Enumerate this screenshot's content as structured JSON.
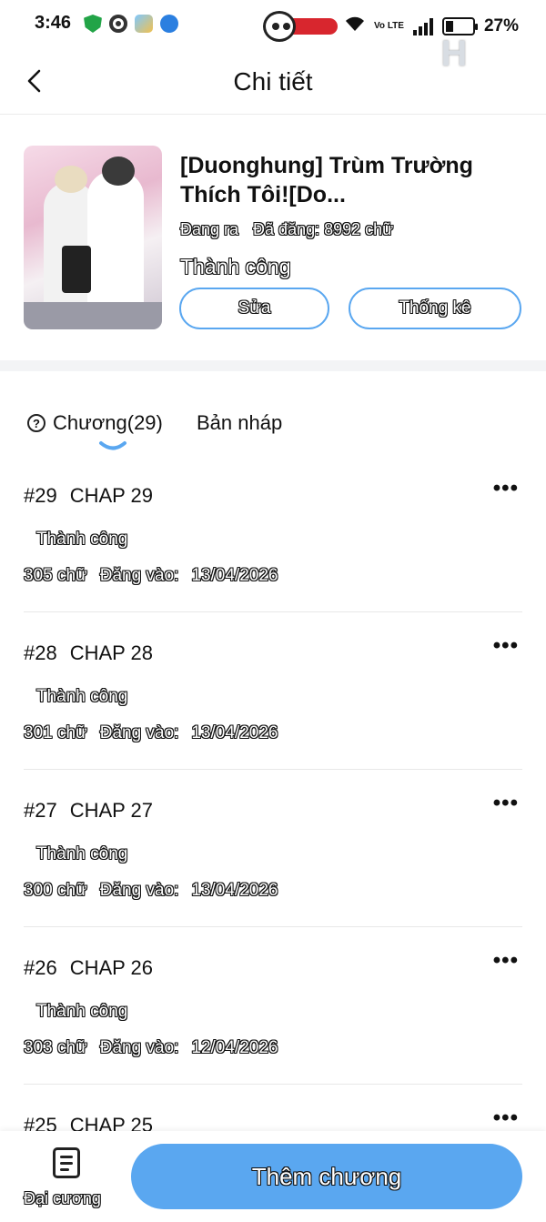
{
  "status_bar": {
    "time": "3:46",
    "network_label": "Vo LTE",
    "battery": "27%",
    "battery_level": 0.27
  },
  "header": {
    "title": "Chi tiết"
  },
  "book": {
    "title": "[Duonghung] Trùm Trường Thích Tôi![Do...",
    "state": "Đang ra",
    "word_count": "Đã đăng: 8992 chữ",
    "status": "Thành công",
    "edit_label": "Sửa",
    "stats_label": "Thống kê"
  },
  "tabs": {
    "chapters_label": "Chương(29)",
    "drafts_label": "Bản nháp",
    "help_symbol": "?"
  },
  "chapters": [
    {
      "number": "#29",
      "name": "CHAP 29",
      "status": "Thành công",
      "words": "305 chữ",
      "date_label": "Đăng vào:",
      "date": "13/04/2026"
    },
    {
      "number": "#28",
      "name": "CHAP 28",
      "status": "Thành công",
      "words": "301 chữ",
      "date_label": "Đăng vào:",
      "date": "13/04/2026"
    },
    {
      "number": "#27",
      "name": "CHAP 27",
      "status": "Thành công",
      "words": "300 chữ",
      "date_label": "Đăng vào:",
      "date": "13/04/2026"
    },
    {
      "number": "#26",
      "name": "CHAP 26",
      "status": "Thành công",
      "words": "303 chữ",
      "date_label": "Đăng vào:",
      "date": "12/04/2026"
    },
    {
      "number": "#25",
      "name": "CHAP 25",
      "status": "",
      "words": "",
      "date_label": "",
      "date": ""
    }
  ],
  "more_symbol": "•••",
  "bottom_bar": {
    "outline_label": "Đại cương",
    "add_chapter_label": "Thêm chương"
  },
  "colors": {
    "accent": "#5aa7f0",
    "divider": "#e8e8e8"
  }
}
